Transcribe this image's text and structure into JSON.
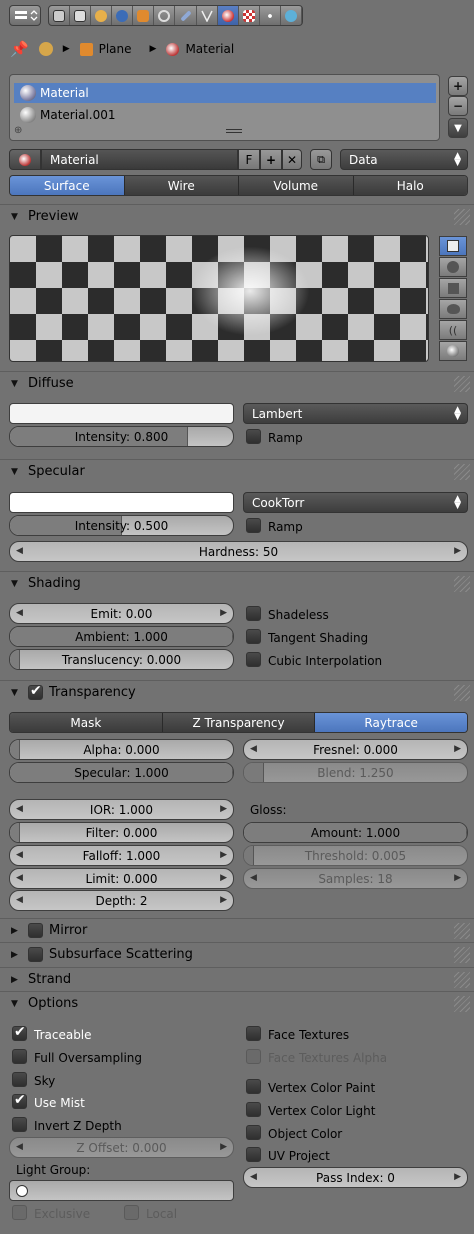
{
  "breadcrumb": {
    "object": "Plane",
    "material": "Material"
  },
  "material_slots": [
    "Material",
    "Material.001"
  ],
  "material_datablock": {
    "name": "Material",
    "fake_user": "F",
    "link": "Data"
  },
  "tabs": [
    "Surface",
    "Wire",
    "Volume",
    "Halo"
  ],
  "panels": {
    "preview": "Preview",
    "diffuse": "Diffuse",
    "specular": "Specular",
    "shading": "Shading",
    "transparency": "Transparency",
    "mirror": "Mirror",
    "sss": "Subsurface Scattering",
    "strand": "Strand",
    "options": "Options"
  },
  "diffuse": {
    "shader": "Lambert",
    "intensity": "Intensity: 0.800",
    "intensity_value": 0.8,
    "ramp": "Ramp"
  },
  "specular": {
    "shader": "CookTorr",
    "intensity": "Intensity: 0.500",
    "intensity_value": 0.5,
    "ramp": "Ramp",
    "hardness": "Hardness: 50"
  },
  "shading": {
    "emit": "Emit: 0.00",
    "ambient": "Ambient: 1.000",
    "ambient_value": 1.0,
    "translucency": "Translucency: 0.000",
    "shadeless": "Shadeless",
    "tangent": "Tangent Shading",
    "cubic": "Cubic Interpolation"
  },
  "transparency": {
    "modes": [
      "Mask",
      "Z Transparency",
      "Raytrace"
    ],
    "alpha": "Alpha: 0.000",
    "specular": "Specular: 1.000",
    "fresnel": "Fresnel: 0.000",
    "blend": "Blend: 1.250",
    "ior": "IOR: 1.000",
    "filter": "Filter: 0.000",
    "falloff": "Falloff: 1.000",
    "limit": "Limit: 0.000",
    "depth": "Depth: 2",
    "gloss": "Gloss:",
    "amount": "Amount: 1.000",
    "threshold": "Threshold: 0.005",
    "samples": "Samples: 18"
  },
  "options": {
    "traceable": "Traceable",
    "full_oversampling": "Full Oversampling",
    "sky": "Sky",
    "use_mist": "Use Mist",
    "invert_z": "Invert Z Depth",
    "z_offset": "Z Offset: 0.000",
    "light_group": "Light Group:",
    "exclusive": "Exclusive",
    "local": "Local",
    "face_textures": "Face Textures",
    "face_textures_alpha": "Face Textures Alpha",
    "vertex_color_paint": "Vertex Color Paint",
    "vertex_color_light": "Vertex Color Light",
    "object_color": "Object Color",
    "uv_project": "UV Project",
    "pass_index": "Pass Index: 0"
  }
}
